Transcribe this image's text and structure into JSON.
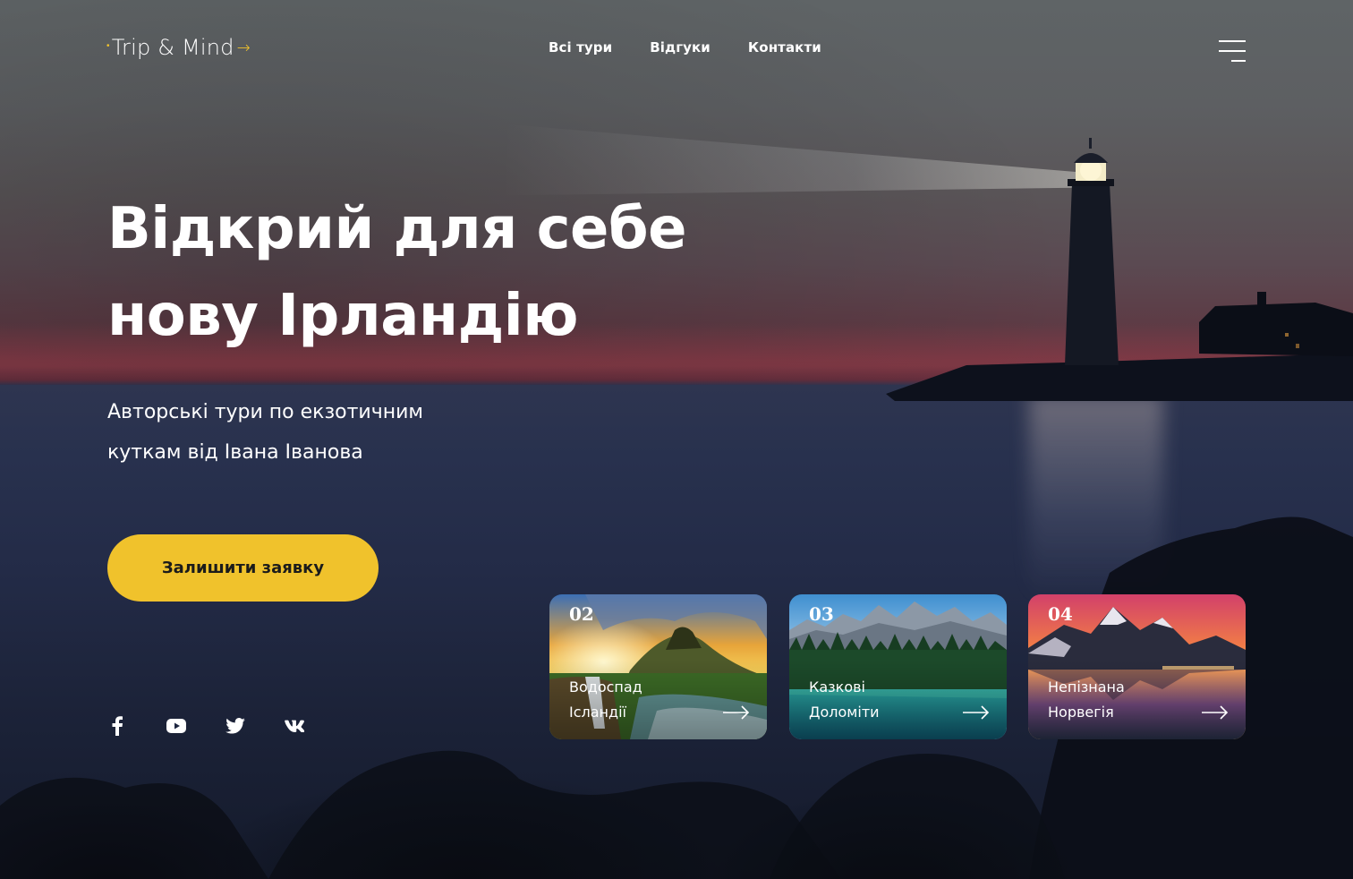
{
  "header": {
    "logo_text": "Trip & Mind",
    "logo_arrow": "→",
    "nav": [
      {
        "label": "Всі тури"
      },
      {
        "label": "Відгуки"
      },
      {
        "label": "Контакти"
      }
    ],
    "menu_icon": "hamburger-menu-icon"
  },
  "hero": {
    "title_line1": "Відкрий для себе",
    "title_line2": "нову Ірландію",
    "subtitle_line1": "Авторські тури по екзотичним",
    "subtitle_line2": "куткам від Івана Іванова",
    "cta_label": "Залишити заявку"
  },
  "socials": [
    {
      "icon": "facebook-icon"
    },
    {
      "icon": "youtube-icon"
    },
    {
      "icon": "twitter-icon"
    },
    {
      "icon": "vk-icon"
    }
  ],
  "tours": [
    {
      "number": "02",
      "line1": "Водоспад",
      "line2": "Ісландії",
      "arrow_icon": "arrow-right-icon"
    },
    {
      "number": "03",
      "line1": "Казкові",
      "line2": "Доломіти",
      "arrow_icon": "arrow-right-icon"
    },
    {
      "number": "04",
      "line1": "Непізнана",
      "line2": "Норвегія",
      "arrow_icon": "arrow-right-icon"
    }
  ],
  "colors": {
    "accent": "#f0c22c",
    "text": "#ffffff",
    "button_text": "#1b1b1b"
  }
}
